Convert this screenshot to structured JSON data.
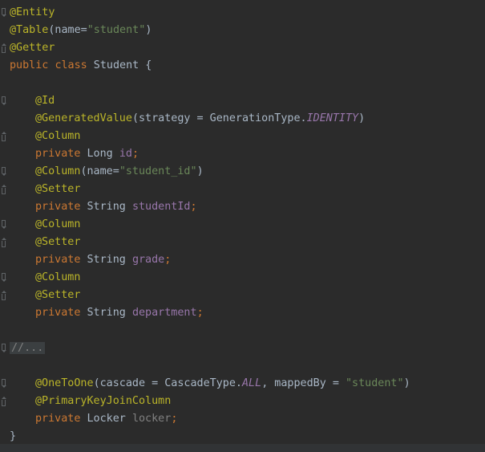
{
  "editor": {
    "theme_colors": {
      "background": "#2b2b2b",
      "annotation": "#bbb529",
      "keyword": "#cc7832",
      "string": "#6a8759",
      "field": "#9876aa",
      "plain": "#a9b7c6"
    },
    "lines": {
      "l1": {
        "ann": "@Entity"
      },
      "l2": {
        "ann": "@Table",
        "p1": "(name=",
        "s1": "\"student\"",
        "p2": ")"
      },
      "l3": {
        "ann": "@Getter"
      },
      "l4": {
        "k1": "public",
        "sp1": " ",
        "k2": "class",
        "p1": " Student {"
      },
      "l6": {
        "ann": "@Id"
      },
      "l7": {
        "ann": "@GeneratedValue",
        "p1": "(strategy = GenerationType.",
        "c1": "IDENTITY",
        "p2": ")"
      },
      "l8": {
        "ann": "@Column"
      },
      "l9": {
        "k1": "private",
        "p1": " Long ",
        "f1": "id",
        "k2": ";"
      },
      "l10": {
        "ann": "@Column",
        "p1": "(name=",
        "s1": "\"student_id\"",
        "p2": ")"
      },
      "l11": {
        "ann": "@Setter"
      },
      "l12": {
        "k1": "private",
        "p1": " String ",
        "f1": "studentId",
        "k2": ";"
      },
      "l13": {
        "ann": "@Column"
      },
      "l14": {
        "ann": "@Setter"
      },
      "l15": {
        "k1": "private",
        "p1": " String ",
        "f1": "grade",
        "k2": ";"
      },
      "l16": {
        "ann": "@Column"
      },
      "l17": {
        "ann": "@Setter"
      },
      "l18": {
        "k1": "private",
        "p1": " String ",
        "f1": "department",
        "k2": ";"
      },
      "l20": {
        "folded": "//..."
      },
      "l22": {
        "ann": "@OneToOne",
        "p1": "(cascade = CascadeType.",
        "c1": "ALL",
        "p2": ", mappedBy = ",
        "s1": "\"student\"",
        "p3": ")"
      },
      "l23": {
        "ann": "@PrimaryKeyJoinColumn"
      },
      "l24": {
        "k1": "private",
        "p1": " Locker ",
        "u1": "locker",
        "k2": ";"
      },
      "l25": {
        "p1": "}"
      }
    }
  }
}
